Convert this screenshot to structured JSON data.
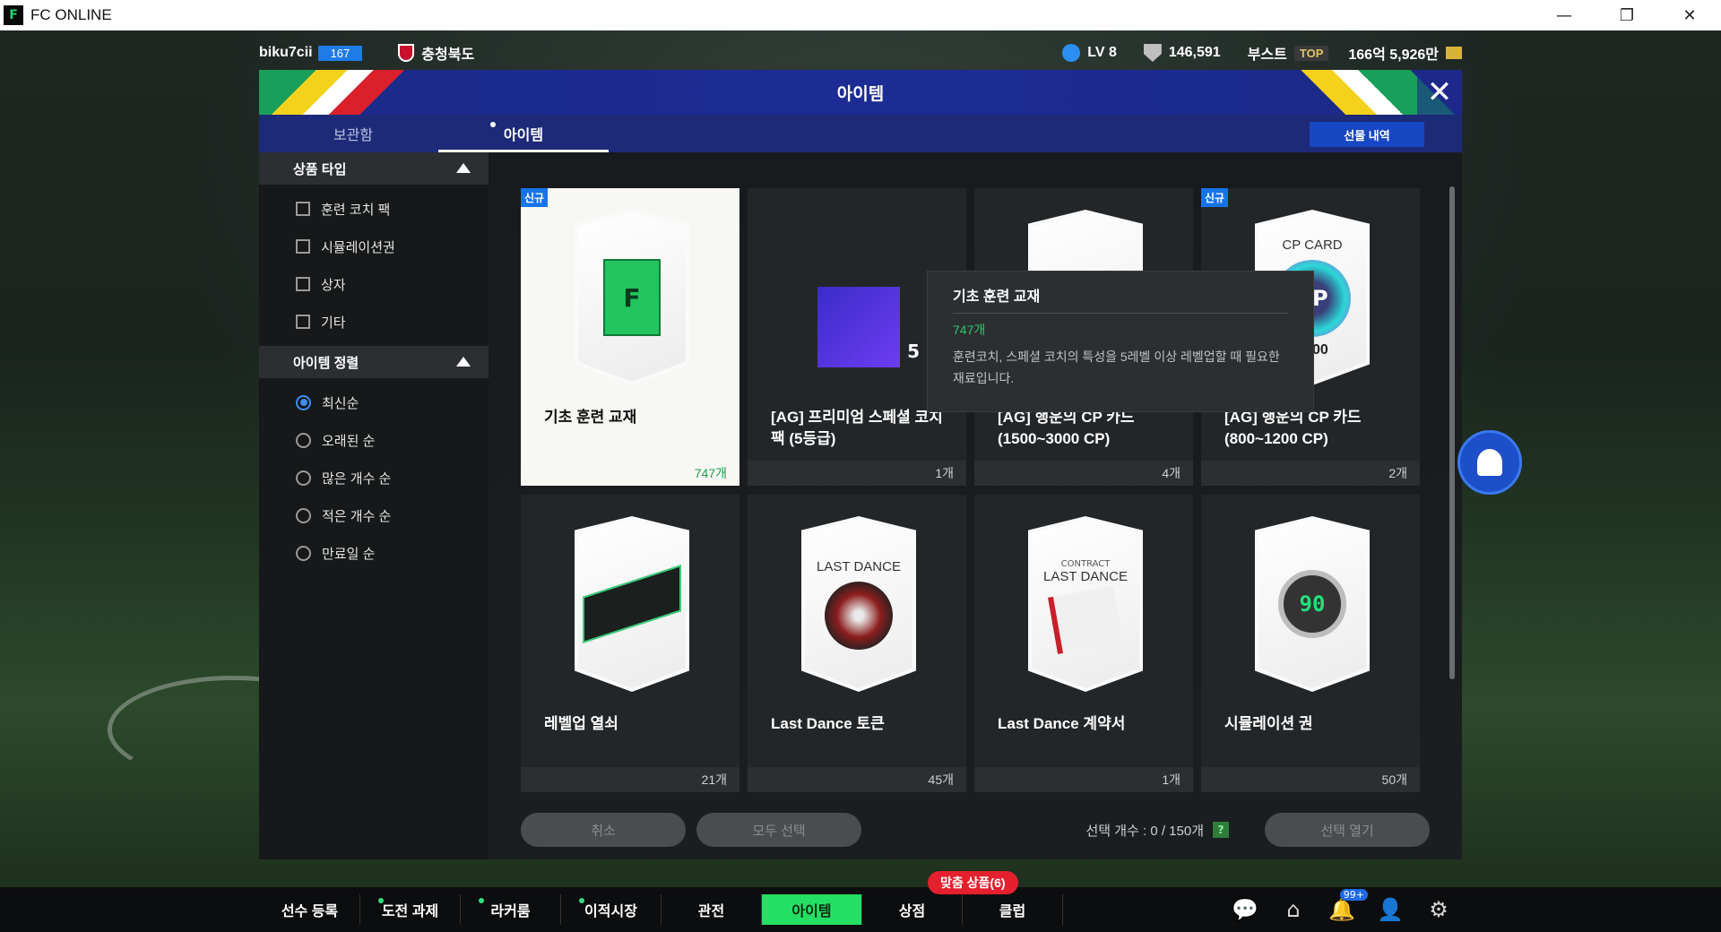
{
  "window": {
    "title": "FC ONLINE",
    "logo": "fc-logo",
    "minimize": "—",
    "maximize": "❐",
    "close": "✕"
  },
  "topbar": {
    "username": "biku7cii",
    "level": "167",
    "region": "충청북도",
    "account_level": "LV 8",
    "points": "146,591",
    "boost_label": "부스트",
    "boost_badge": "TOP",
    "money": "166억 5,926만"
  },
  "panel": {
    "title": "아이템",
    "close": "✕",
    "tabs": [
      {
        "label": "보관함"
      },
      {
        "label": "아이템"
      }
    ],
    "gift_button": "선물 내역"
  },
  "sidebar": {
    "type_header": "상품 타입",
    "types": [
      {
        "label": "훈련 코치 팩"
      },
      {
        "label": "시뮬레이션권"
      },
      {
        "label": "상자"
      },
      {
        "label": "기타"
      }
    ],
    "sort_header": "아이템 정렬",
    "sorts": [
      {
        "label": "최신순",
        "selected": true
      },
      {
        "label": "오래된 순"
      },
      {
        "label": "많은 개수 순"
      },
      {
        "label": "적은 개수 순"
      },
      {
        "label": "만료일 순"
      }
    ]
  },
  "items": [
    {
      "name": "기초 훈련 교재",
      "count": "747개",
      "badge": "신규",
      "art": "TRAINING BOOK"
    },
    {
      "name": "[AG] 프리미엄 스페셜 코치팩 (5등급)",
      "count": "1개",
      "grade": "5"
    },
    {
      "name": "[AG] 행운의 CP 카드 (1500~3000 CP)",
      "count": "4개",
      "range": "3000"
    },
    {
      "name": "[AG] 행운의 CP 카드 (800~1200 CP)",
      "count": "2개",
      "badge": "신규",
      "art": "CP CARD",
      "range": "1200"
    },
    {
      "name": "레벨업 열쇠",
      "count": "21개"
    },
    {
      "name": "Last Dance 토큰",
      "count": "45개",
      "art": "LAST DANCE"
    },
    {
      "name": "Last Dance 계약서",
      "count": "1개",
      "art_sub": "CONTRACT",
      "art": "LAST DANCE"
    },
    {
      "name": "시뮬레이션 권",
      "count": "50개",
      "art": "90"
    }
  ],
  "tooltip": {
    "title": "기초 훈련 교재",
    "count": "747개",
    "desc": "훈련코치, 스페셜 코치의 특성을 5레벨 이상 레벨업할 때 필요한 재료입니다."
  },
  "actions": {
    "cancel": "취소",
    "select_all": "모두 선택",
    "selected_count": "선택 개수 : 0 / 150개",
    "help": "?",
    "open_selected": "선택 열기"
  },
  "bottomnav": {
    "items": [
      {
        "label": "선수 등록"
      },
      {
        "label": "도전 과제",
        "dot": true
      },
      {
        "label": "라커룸",
        "dot": true
      },
      {
        "label": "이적시장",
        "dot": true
      },
      {
        "label": "관전"
      },
      {
        "label": "아이템",
        "active": true
      },
      {
        "label": "상점"
      },
      {
        "label": "클럽"
      }
    ],
    "promo": "맞춤 상품(6)",
    "notif_badge": "99+",
    "icons": [
      "chat-icon",
      "home-icon",
      "bell-icon",
      "profile-icon",
      "settings-icon"
    ]
  }
}
